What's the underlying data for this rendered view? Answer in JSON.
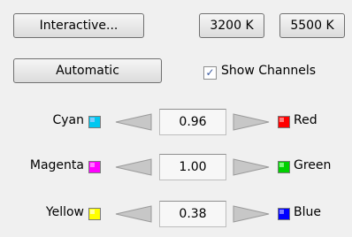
{
  "buttons": {
    "interactive": "Interactive...",
    "k3200": "3200 K",
    "k5500": "5500 K",
    "automatic": "Automatic"
  },
  "show_channels": {
    "label": "Show Channels",
    "checked": true
  },
  "rows": [
    {
      "left_label": "Cyan",
      "left_color": "#00c8f0",
      "value": "0.96",
      "right_label": "Red",
      "right_color": "#ff0000"
    },
    {
      "left_label": "Magenta",
      "left_color": "#ff00ff",
      "value": "1.00",
      "right_label": "Green",
      "right_color": "#00d000"
    },
    {
      "left_label": "Yellow",
      "left_color": "#ffff00",
      "value": "0.38",
      "right_label": "Blue",
      "right_color": "#0000ff"
    }
  ]
}
